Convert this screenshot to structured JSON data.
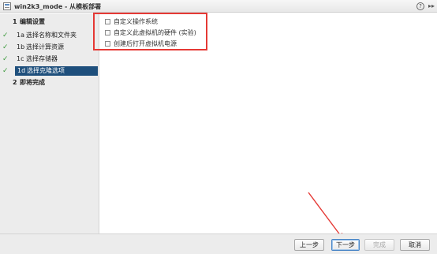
{
  "window": {
    "title": "win2k3_mode - 从模板部署",
    "help_glyph": "?",
    "expand_glyph": "▸▸"
  },
  "sidebar": {
    "steps": [
      {
        "num": "1",
        "label": "编辑设置",
        "check": ""
      },
      {
        "num": "1a",
        "label": "选择名称和文件夹",
        "check": "✓"
      },
      {
        "num": "1b",
        "label": "选择计算资源",
        "check": "✓"
      },
      {
        "num": "1c",
        "label": "选择存储器",
        "check": "✓"
      },
      {
        "num": "1d",
        "label": "选择克隆选项",
        "check": "✓"
      },
      {
        "num": "2",
        "label": "即将完成",
        "check": ""
      }
    ],
    "active_index": 4
  },
  "clone_options": [
    {
      "label": "自定义操作系统",
      "checked": false
    },
    {
      "label": "自定义此虚拟机的硬件 (实验)",
      "checked": false
    },
    {
      "label": "创建后打开虚拟机电源",
      "checked": false
    }
  ],
  "footer": {
    "back_label": "上一步",
    "next_label": "下一步",
    "finish_label": "完成",
    "cancel_label": "取消"
  },
  "colors": {
    "highlight_box": "#e53935",
    "active_step_bg": "#1e4f7c",
    "check": "#3c9a3c"
  }
}
